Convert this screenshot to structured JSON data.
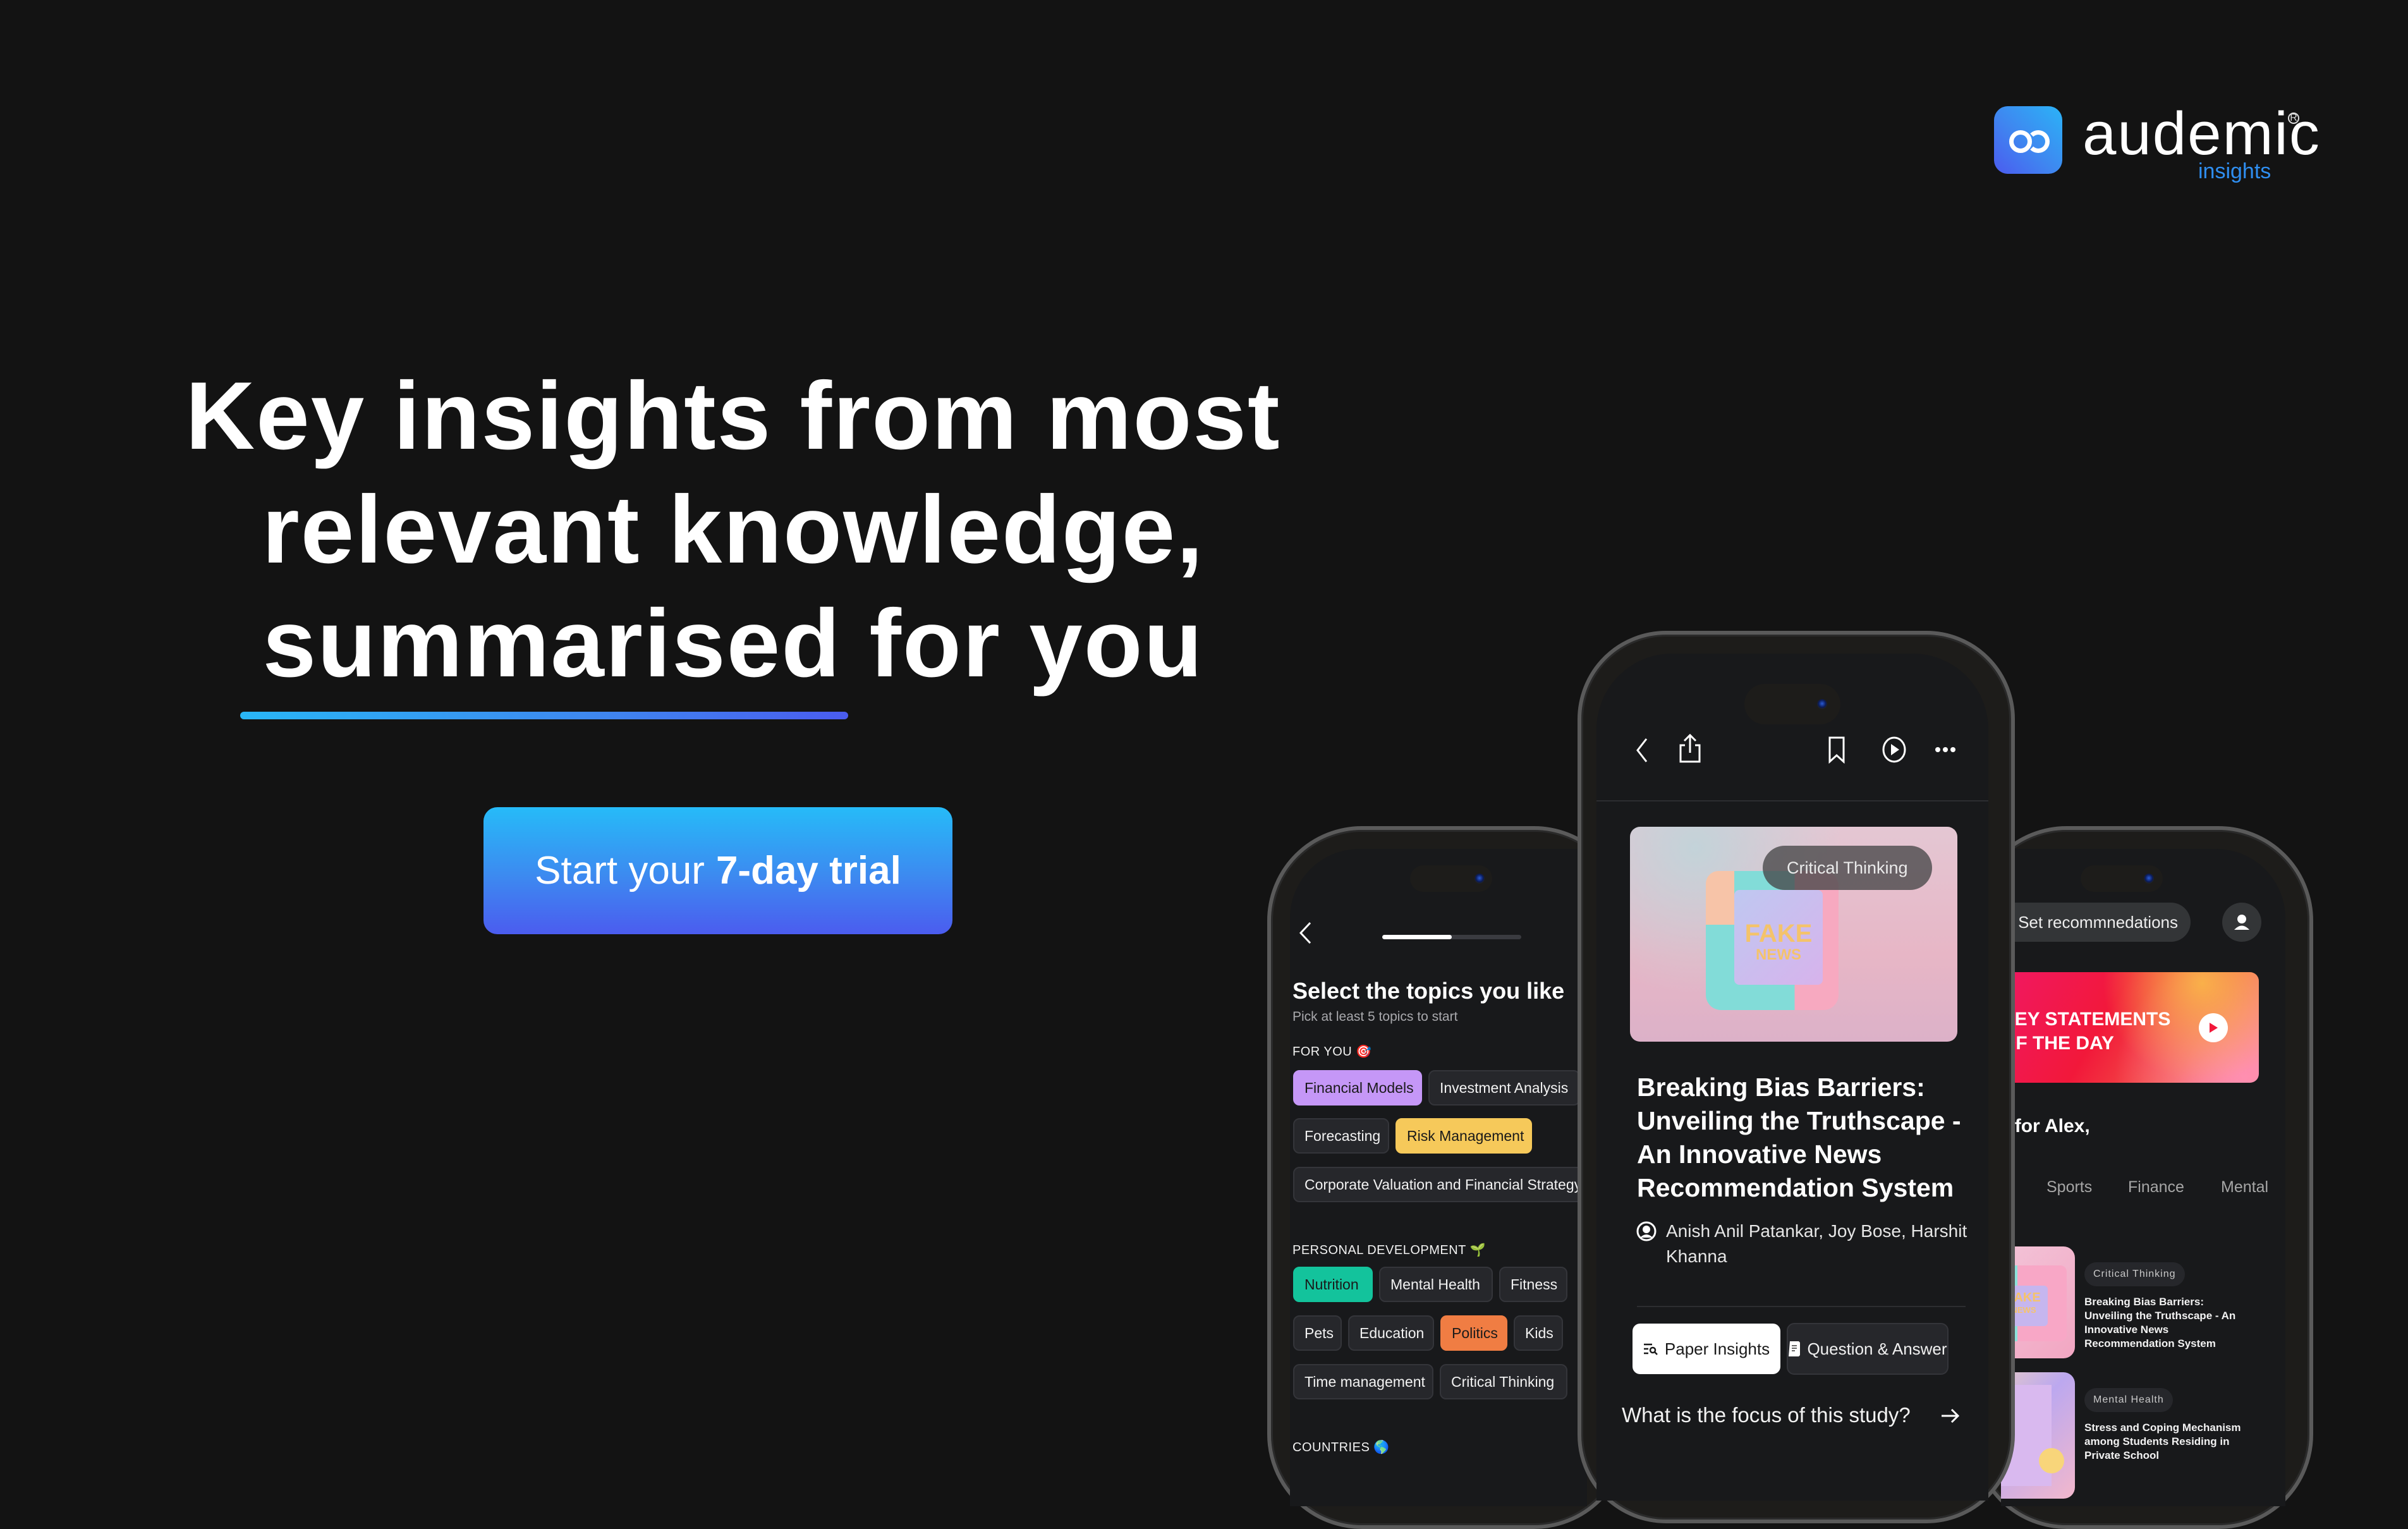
{
  "brand": {
    "name": "audemic",
    "registered": "R",
    "subtitle": "insights",
    "colors": {
      "accent": "#2f8ef0",
      "gradient_start": "#26bbf8",
      "gradient_end": "#4b5cef",
      "background": "#131313"
    }
  },
  "hero": {
    "headline_lines": [
      "Key insights from most",
      "relevant knowledge,",
      "summarised for you"
    ],
    "cta": {
      "prefix": "Start your",
      "bold": "7-day trial"
    }
  },
  "phone_topics": {
    "progress": 0.5,
    "title": "Select the topics you like",
    "subtitle": "Pick at least 5 topics to start",
    "sections": [
      {
        "label": "FOR YOU",
        "emoji": "🎯",
        "topics": [
          {
            "label": "Financial Models",
            "selected": true,
            "color": "#c597f7"
          },
          {
            "label": "Investment Analysis",
            "selected": false
          },
          {
            "label": "Forecasting",
            "selected": false
          },
          {
            "label": "Risk Management",
            "selected": true,
            "color": "#f6c95a"
          },
          {
            "label": "Corporate Valuation and Financial Strategy",
            "selected": false
          }
        ]
      },
      {
        "label": "PERSONAL DEVELOPMENT",
        "emoji": "🌱",
        "topics": [
          {
            "label": "Nutrition",
            "selected": true,
            "color": "#13c39c"
          },
          {
            "label": "Mental Health",
            "selected": false
          },
          {
            "label": "Fitness",
            "selected": false
          },
          {
            "label": "Pets",
            "selected": false
          },
          {
            "label": "Education",
            "selected": false
          },
          {
            "label": "Politics",
            "selected": true,
            "color": "#f07d43"
          },
          {
            "label": "Kids",
            "selected": false
          },
          {
            "label": "Time management",
            "selected": false
          },
          {
            "label": "Critical Thinking",
            "selected": false
          }
        ]
      },
      {
        "label": "COUNTRIES",
        "emoji": "🌎",
        "topics": []
      }
    ]
  },
  "phone_paper": {
    "toolbar_icons": [
      "back-icon",
      "share-icon",
      "bookmark-icon",
      "play-icon",
      "more-icon"
    ],
    "image_tag": "Critical Thinking",
    "image_text": [
      "FAKE",
      "NEWS"
    ],
    "title": "Breaking Bias Barriers: Unveiling the Truthscape - An Innovative News Recommendation System",
    "authors": "Anish Anil Patankar, Joy Bose, Harshit Khanna",
    "tabs": [
      {
        "label": "Paper Insights",
        "active": true
      },
      {
        "label": "Question & Answer",
        "active": false
      }
    ],
    "question": "What is the focus of this study?"
  },
  "phone_home": {
    "recommendations_button": "Set recommnedations",
    "banner_lines": [
      "KEY STATEMENTS",
      "OF THE DAY"
    ],
    "greeting": "Selected for Alex,",
    "categories": [
      "Sports",
      "Finance",
      "Mental"
    ],
    "feed": [
      {
        "tag": "Critical Thinking",
        "title": "Breaking Bias Barriers: Unveiling the Truthscape - An Innovative News Recommendation System",
        "thumb_text": [
          "FAKE",
          "NEWS"
        ]
      },
      {
        "tag": "Mental Health",
        "title": "Stress and Coping Mechanism among Students Residing in Private School"
      }
    ]
  }
}
